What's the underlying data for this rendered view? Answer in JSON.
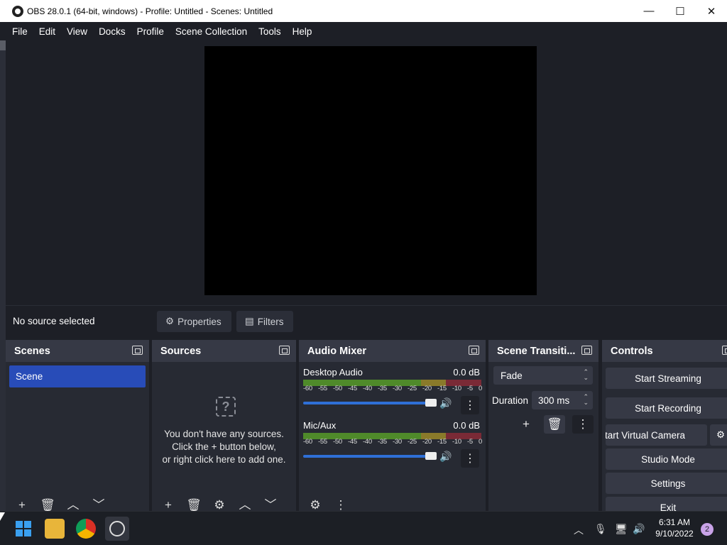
{
  "titlebar": {
    "title": "OBS 28.0.1 (64-bit, windows) - Profile: Untitled - Scenes: Untitled",
    "minimize": "—",
    "maximize": "☐",
    "close": "✕"
  },
  "menu": [
    "File",
    "Edit",
    "View",
    "Docks",
    "Profile",
    "Scene Collection",
    "Tools",
    "Help"
  ],
  "source_bar": {
    "status": "No source selected",
    "properties": "Properties",
    "filters": "Filters"
  },
  "scenes": {
    "title": "Scenes",
    "items": [
      "Scene"
    ]
  },
  "sources": {
    "title": "Sources",
    "empty_line1": "You don't have any sources.",
    "empty_line2": "Click the + button below,",
    "empty_line3": "or right click here to add one."
  },
  "audio": {
    "title": "Audio Mixer",
    "ticks": [
      "-60",
      "-55",
      "-50",
      "-45",
      "-40",
      "-35",
      "-30",
      "-25",
      "-20",
      "-15",
      "-10",
      "-5",
      "0"
    ],
    "channels": [
      {
        "name": "Desktop Audio",
        "db": "0.0 dB",
        "volume": 1.0
      },
      {
        "name": "Mic/Aux",
        "db": "0.0 dB",
        "volume": 1.0
      }
    ]
  },
  "transitions": {
    "title": "Scene Transiti...",
    "selected": "Fade",
    "duration_label": "Duration",
    "duration_value": "300 ms"
  },
  "controls": {
    "title": "Controls",
    "start_streaming": "Start Streaming",
    "start_recording": "Start Recording",
    "start_virtual_camera": "Start Virtual Camera",
    "studio_mode": "Studio Mode",
    "settings": "Settings",
    "exit": "Exit"
  },
  "taskbar": {
    "time": "6:31 AM",
    "date": "9/10/2022",
    "notifications": "2"
  }
}
